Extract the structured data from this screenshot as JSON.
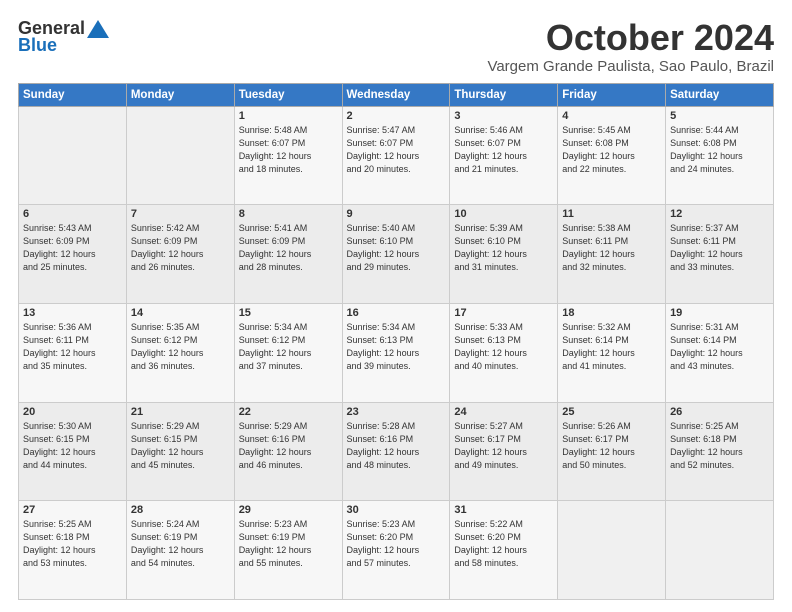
{
  "header": {
    "logo_general": "General",
    "logo_blue": "Blue",
    "month_title": "October 2024",
    "location": "Vargem Grande Paulista, Sao Paulo, Brazil"
  },
  "days_of_week": [
    "Sunday",
    "Monday",
    "Tuesday",
    "Wednesday",
    "Thursday",
    "Friday",
    "Saturday"
  ],
  "weeks": [
    [
      {
        "num": "",
        "info": ""
      },
      {
        "num": "",
        "info": ""
      },
      {
        "num": "1",
        "info": "Sunrise: 5:48 AM\nSunset: 6:07 PM\nDaylight: 12 hours\nand 18 minutes."
      },
      {
        "num": "2",
        "info": "Sunrise: 5:47 AM\nSunset: 6:07 PM\nDaylight: 12 hours\nand 20 minutes."
      },
      {
        "num": "3",
        "info": "Sunrise: 5:46 AM\nSunset: 6:07 PM\nDaylight: 12 hours\nand 21 minutes."
      },
      {
        "num": "4",
        "info": "Sunrise: 5:45 AM\nSunset: 6:08 PM\nDaylight: 12 hours\nand 22 minutes."
      },
      {
        "num": "5",
        "info": "Sunrise: 5:44 AM\nSunset: 6:08 PM\nDaylight: 12 hours\nand 24 minutes."
      }
    ],
    [
      {
        "num": "6",
        "info": "Sunrise: 5:43 AM\nSunset: 6:09 PM\nDaylight: 12 hours\nand 25 minutes."
      },
      {
        "num": "7",
        "info": "Sunrise: 5:42 AM\nSunset: 6:09 PM\nDaylight: 12 hours\nand 26 minutes."
      },
      {
        "num": "8",
        "info": "Sunrise: 5:41 AM\nSunset: 6:09 PM\nDaylight: 12 hours\nand 28 minutes."
      },
      {
        "num": "9",
        "info": "Sunrise: 5:40 AM\nSunset: 6:10 PM\nDaylight: 12 hours\nand 29 minutes."
      },
      {
        "num": "10",
        "info": "Sunrise: 5:39 AM\nSunset: 6:10 PM\nDaylight: 12 hours\nand 31 minutes."
      },
      {
        "num": "11",
        "info": "Sunrise: 5:38 AM\nSunset: 6:11 PM\nDaylight: 12 hours\nand 32 minutes."
      },
      {
        "num": "12",
        "info": "Sunrise: 5:37 AM\nSunset: 6:11 PM\nDaylight: 12 hours\nand 33 minutes."
      }
    ],
    [
      {
        "num": "13",
        "info": "Sunrise: 5:36 AM\nSunset: 6:11 PM\nDaylight: 12 hours\nand 35 minutes."
      },
      {
        "num": "14",
        "info": "Sunrise: 5:35 AM\nSunset: 6:12 PM\nDaylight: 12 hours\nand 36 minutes."
      },
      {
        "num": "15",
        "info": "Sunrise: 5:34 AM\nSunset: 6:12 PM\nDaylight: 12 hours\nand 37 minutes."
      },
      {
        "num": "16",
        "info": "Sunrise: 5:34 AM\nSunset: 6:13 PM\nDaylight: 12 hours\nand 39 minutes."
      },
      {
        "num": "17",
        "info": "Sunrise: 5:33 AM\nSunset: 6:13 PM\nDaylight: 12 hours\nand 40 minutes."
      },
      {
        "num": "18",
        "info": "Sunrise: 5:32 AM\nSunset: 6:14 PM\nDaylight: 12 hours\nand 41 minutes."
      },
      {
        "num": "19",
        "info": "Sunrise: 5:31 AM\nSunset: 6:14 PM\nDaylight: 12 hours\nand 43 minutes."
      }
    ],
    [
      {
        "num": "20",
        "info": "Sunrise: 5:30 AM\nSunset: 6:15 PM\nDaylight: 12 hours\nand 44 minutes."
      },
      {
        "num": "21",
        "info": "Sunrise: 5:29 AM\nSunset: 6:15 PM\nDaylight: 12 hours\nand 45 minutes."
      },
      {
        "num": "22",
        "info": "Sunrise: 5:29 AM\nSunset: 6:16 PM\nDaylight: 12 hours\nand 46 minutes."
      },
      {
        "num": "23",
        "info": "Sunrise: 5:28 AM\nSunset: 6:16 PM\nDaylight: 12 hours\nand 48 minutes."
      },
      {
        "num": "24",
        "info": "Sunrise: 5:27 AM\nSunset: 6:17 PM\nDaylight: 12 hours\nand 49 minutes."
      },
      {
        "num": "25",
        "info": "Sunrise: 5:26 AM\nSunset: 6:17 PM\nDaylight: 12 hours\nand 50 minutes."
      },
      {
        "num": "26",
        "info": "Sunrise: 5:25 AM\nSunset: 6:18 PM\nDaylight: 12 hours\nand 52 minutes."
      }
    ],
    [
      {
        "num": "27",
        "info": "Sunrise: 5:25 AM\nSunset: 6:18 PM\nDaylight: 12 hours\nand 53 minutes."
      },
      {
        "num": "28",
        "info": "Sunrise: 5:24 AM\nSunset: 6:19 PM\nDaylight: 12 hours\nand 54 minutes."
      },
      {
        "num": "29",
        "info": "Sunrise: 5:23 AM\nSunset: 6:19 PM\nDaylight: 12 hours\nand 55 minutes."
      },
      {
        "num": "30",
        "info": "Sunrise: 5:23 AM\nSunset: 6:20 PM\nDaylight: 12 hours\nand 57 minutes."
      },
      {
        "num": "31",
        "info": "Sunrise: 5:22 AM\nSunset: 6:20 PM\nDaylight: 12 hours\nand 58 minutes."
      },
      {
        "num": "",
        "info": ""
      },
      {
        "num": "",
        "info": ""
      }
    ]
  ]
}
